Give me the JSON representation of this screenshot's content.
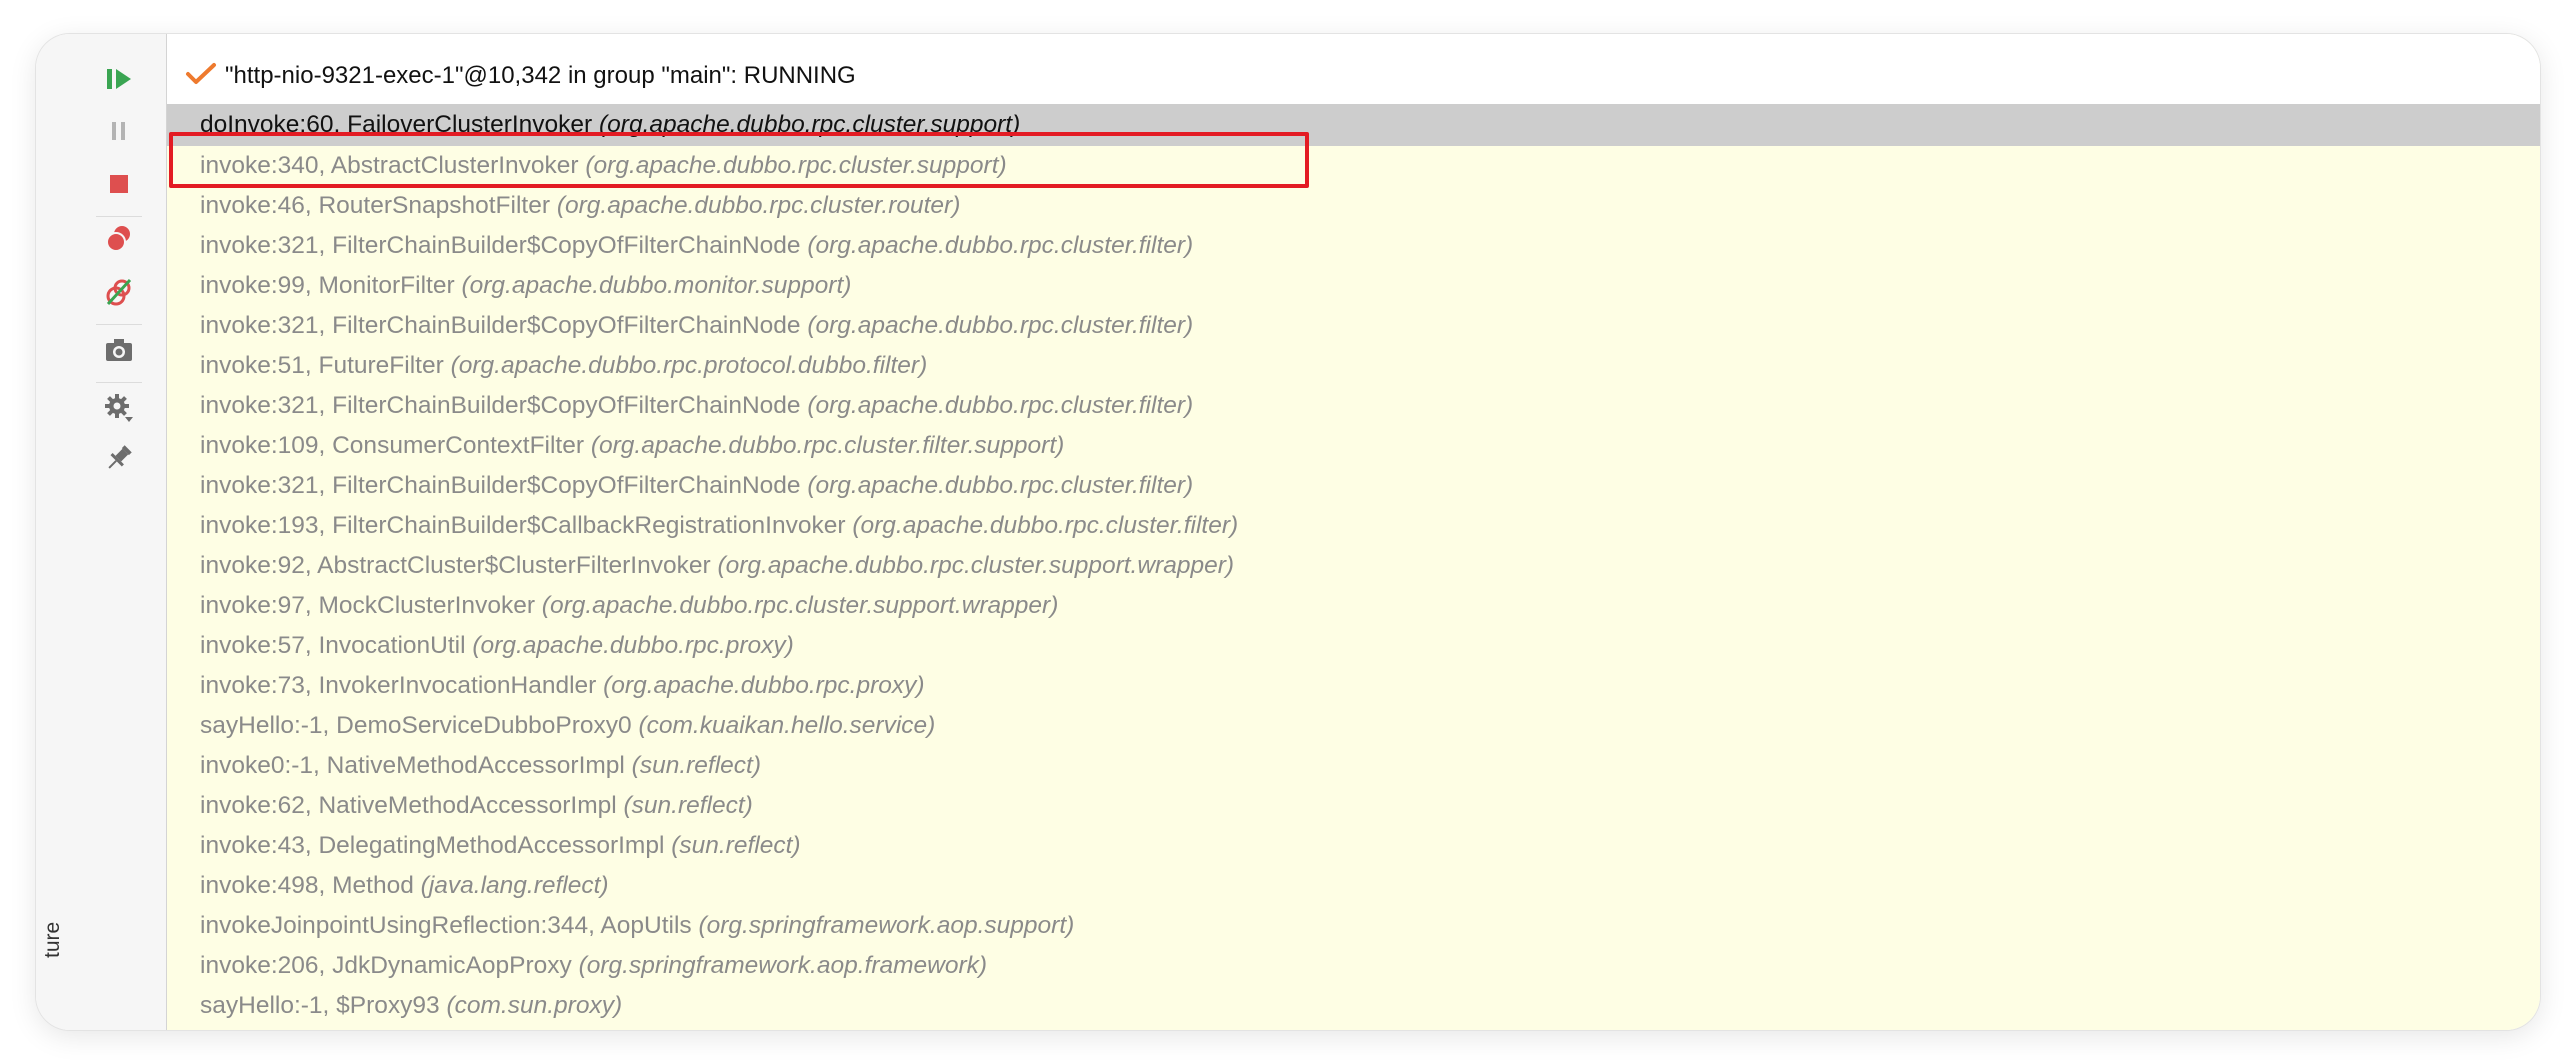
{
  "side_panel": {
    "label": "ture"
  },
  "toolbar": {
    "items": [
      {
        "icon": "resume-icon",
        "enabled": true
      },
      {
        "icon": "pause-icon",
        "enabled": false
      },
      {
        "icon": "stop-icon",
        "enabled": true
      },
      {
        "icon": "view-breakpoints-icon",
        "enabled": true
      },
      {
        "icon": "mute-breakpoints-icon",
        "enabled": true
      },
      {
        "icon": "camera-icon",
        "enabled": true
      },
      {
        "icon": "settings-icon",
        "enabled": true
      },
      {
        "icon": "pin-icon",
        "enabled": true
      }
    ]
  },
  "thread": {
    "status_icon": "checkmark-icon",
    "label": "\"http-nio-9321-exec-1\"@10,342 in group \"main\": RUNNING"
  },
  "frames": [
    {
      "method": "doInvoke:60, FailoverClusterInvoker ",
      "package": "(org.apache.dubbo.rpc.cluster.support)",
      "selected": true
    },
    {
      "method": "invoke:340, AbstractClusterInvoker ",
      "package": "(org.apache.dubbo.rpc.cluster.support)"
    },
    {
      "method": "invoke:46, RouterSnapshotFilter ",
      "package": "(org.apache.dubbo.rpc.cluster.router)"
    },
    {
      "method": "invoke:321, FilterChainBuilder$CopyOfFilterChainNode ",
      "package": "(org.apache.dubbo.rpc.cluster.filter)"
    },
    {
      "method": "invoke:99, MonitorFilter ",
      "package": "(org.apache.dubbo.monitor.support)"
    },
    {
      "method": "invoke:321, FilterChainBuilder$CopyOfFilterChainNode ",
      "package": "(org.apache.dubbo.rpc.cluster.filter)"
    },
    {
      "method": "invoke:51, FutureFilter ",
      "package": "(org.apache.dubbo.rpc.protocol.dubbo.filter)"
    },
    {
      "method": "invoke:321, FilterChainBuilder$CopyOfFilterChainNode ",
      "package": "(org.apache.dubbo.rpc.cluster.filter)"
    },
    {
      "method": "invoke:109, ConsumerContextFilter ",
      "package": "(org.apache.dubbo.rpc.cluster.filter.support)"
    },
    {
      "method": "invoke:321, FilterChainBuilder$CopyOfFilterChainNode ",
      "package": "(org.apache.dubbo.rpc.cluster.filter)"
    },
    {
      "method": "invoke:193, FilterChainBuilder$CallbackRegistrationInvoker ",
      "package": "(org.apache.dubbo.rpc.cluster.filter)"
    },
    {
      "method": "invoke:92, AbstractCluster$ClusterFilterInvoker ",
      "package": "(org.apache.dubbo.rpc.cluster.support.wrapper)"
    },
    {
      "method": "invoke:97, MockClusterInvoker ",
      "package": "(org.apache.dubbo.rpc.cluster.support.wrapper)"
    },
    {
      "method": "invoke:57, InvocationUtil ",
      "package": "(org.apache.dubbo.rpc.proxy)"
    },
    {
      "method": "invoke:73, InvokerInvocationHandler ",
      "package": "(org.apache.dubbo.rpc.proxy)"
    },
    {
      "method": "sayHello:-1, DemoServiceDubboProxy0 ",
      "package": "(com.kuaikan.hello.service)"
    },
    {
      "method": "invoke0:-1, NativeMethodAccessorImpl ",
      "package": "(sun.reflect)"
    },
    {
      "method": "invoke:62, NativeMethodAccessorImpl ",
      "package": "(sun.reflect)"
    },
    {
      "method": "invoke:43, DelegatingMethodAccessorImpl ",
      "package": "(sun.reflect)"
    },
    {
      "method": "invoke:498, Method ",
      "package": "(java.lang.reflect)"
    },
    {
      "method": "invokeJoinpointUsingReflection:344, AopUtils ",
      "package": "(org.springframework.aop.support)"
    },
    {
      "method": "invoke:206, JdkDynamicAopProxy ",
      "package": "(org.springframework.aop.framework)"
    },
    {
      "method": "sayHello:-1, $Proxy93 ",
      "package": "(com.sun.proxy)"
    }
  ],
  "colors": {
    "frames_background": "#fefee4",
    "selected_background": "#cdcdcd",
    "highlight_border": "#e31b23",
    "resume_green": "#3aa552",
    "stop_red": "#de4f4f",
    "checkmark_orange": "#ee7a2e"
  }
}
